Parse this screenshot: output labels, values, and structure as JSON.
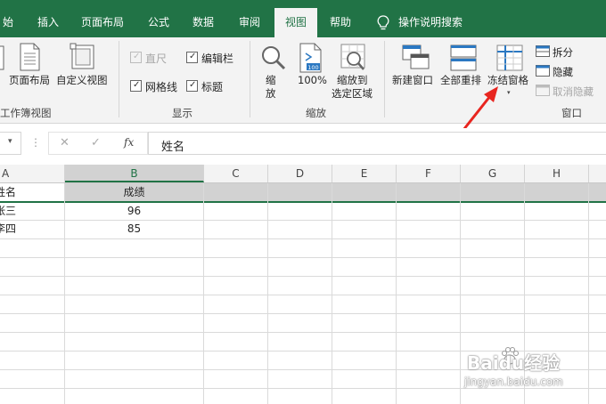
{
  "tabs": [
    {
      "label": "始"
    },
    {
      "label": "插入"
    },
    {
      "label": "页面布局"
    },
    {
      "label": "公式"
    },
    {
      "label": "数据"
    },
    {
      "label": "审阅"
    },
    {
      "label": "视图"
    },
    {
      "label": "帮助"
    },
    {
      "label": "操作说明搜索"
    }
  ],
  "active_tab": "视图",
  "ribbon": {
    "workbook_views": {
      "label": "工作簿视图",
      "page_layout": "页面布局",
      "custom_views": "自定义视图"
    },
    "show": {
      "label": "显示",
      "ruler": "直尺",
      "formula_bar": "编辑栏",
      "gridlines": "网格线",
      "headings": "标题"
    },
    "zoom": {
      "label": "缩放",
      "zoom_line1": "缩",
      "zoom_line2": "放",
      "zoom_100": "100%",
      "zoom_sel_line1": "缩放到",
      "zoom_sel_line2": "选定区域",
      "icon_100": "100"
    },
    "window": {
      "label": "窗口",
      "new_window": "新建窗口",
      "arrange_all": "全部重排",
      "freeze_panes": "冻结窗格",
      "split": "拆分",
      "hide": "隐藏",
      "unhide": "取消隐藏"
    }
  },
  "formula_bar": {
    "fx": "fx",
    "content": "姓名"
  },
  "columns": [
    "A",
    "B",
    "C",
    "D",
    "E",
    "F",
    "G",
    "H"
  ],
  "rows": [
    [
      "姓名",
      "成绩"
    ],
    [
      "张三",
      "96"
    ],
    [
      "李四",
      "85"
    ]
  ],
  "watermark": {
    "brand": "Baidu经验",
    "url": "jingyan.baidu.com"
  },
  "colors": {
    "excel_green": "#217346",
    "arrow_red": "#e8251f"
  }
}
